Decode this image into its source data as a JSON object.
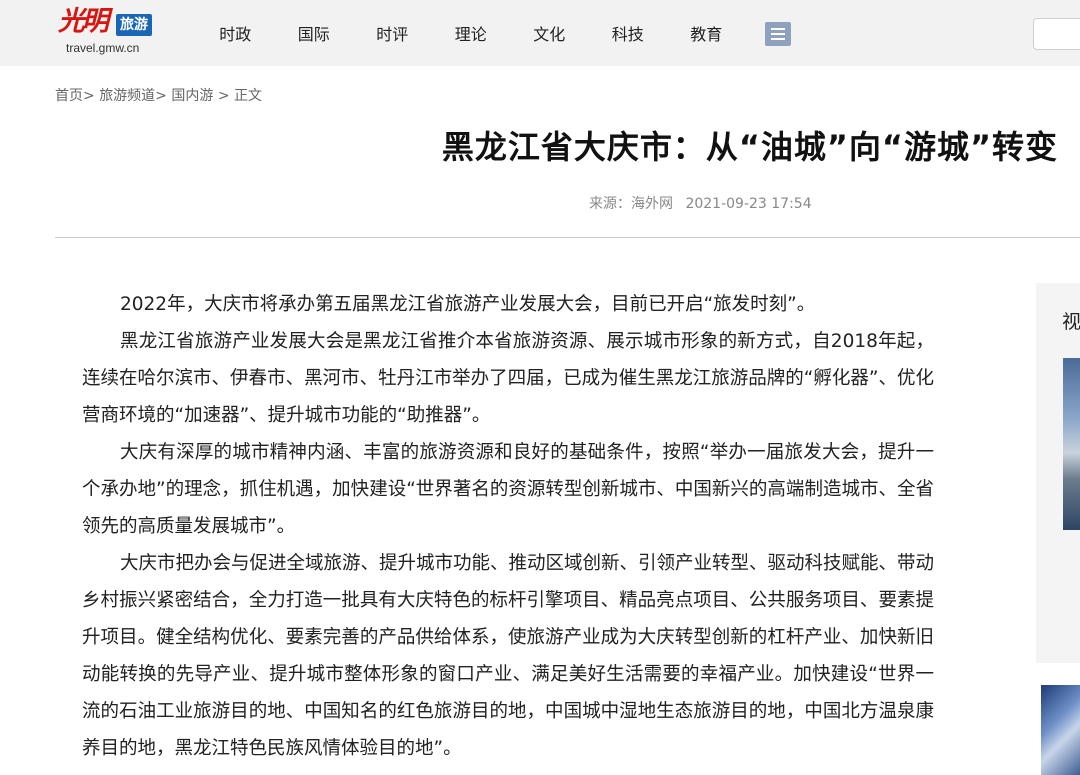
{
  "header": {
    "logo_script": "光明",
    "logo_badge": "旅游",
    "logo_domain": "travel.gmw.cn",
    "nav": [
      "时政",
      "国际",
      "时评",
      "理论",
      "文化",
      "科技",
      "教育"
    ]
  },
  "breadcrumb": [
    "首页>",
    "旅游频道>",
    "国内游",
    ">",
    "正文"
  ],
  "article": {
    "title": "黑龙江省大庆市：从“油城”向“游城”转变",
    "source": "来源：海外网",
    "date": "2021-09-23 17:54",
    "paragraphs": [
      "2022年，大庆市将承办第五届黑龙江省旅游产业发展大会，目前已开启“旅发时刻”。",
      "黑龙江省旅游产业发展大会是黑龙江省推介本省旅游资源、展示城市形象的新方式，自2018年起，连续在哈尔滨市、伊春市、黑河市、牡丹江市举办了四届，已成为催生黑龙江旅游品牌的“孵化器”、优化营商环境的“加速器”、提升城市功能的“助推器”。",
      "大庆有深厚的城市精神内涵、丰富的旅游资源和良好的基础条件，按照“举办一届旅发大会，提升一个承办地”的理念，抓住机遇，加快建设“世界著名的资源转型创新城市、中国新兴的高端制造城市、全省领先的高质量发展城市”。",
      "大庆市把办会与促进全域旅游、提升城市功能、推动区域创新、引领产业转型、驱动科技赋能、带动乡村振兴紧密结合，全力打造一批具有大庆特色的标杆引擎项目、精品亮点项目、公共服务项目、要素提升项目。健全结构优化、要素完善的产品供给体系，使旅游产业成为大庆转型创新的杠杆产业、加快新旧动能转换的先导产业、提升城市整体形象的窗口产业、满足美好生活需要的幸福产业。加快建设“世界一流的石油工业旅游目的地、中国知名的红色旅游目的地，中国城中湿地生态旅游目的地，中国北方温泉康养目的地，黑龙江特色民族风情体验目的地”。"
    ]
  },
  "sidebar": {
    "title": "视"
  },
  "icons": {
    "menu": "list-menu-icon"
  },
  "colors": {
    "logo_red": "#d7140e",
    "badge_blue": "#1a66b4",
    "topbar_bg": "#f2f2f2"
  }
}
